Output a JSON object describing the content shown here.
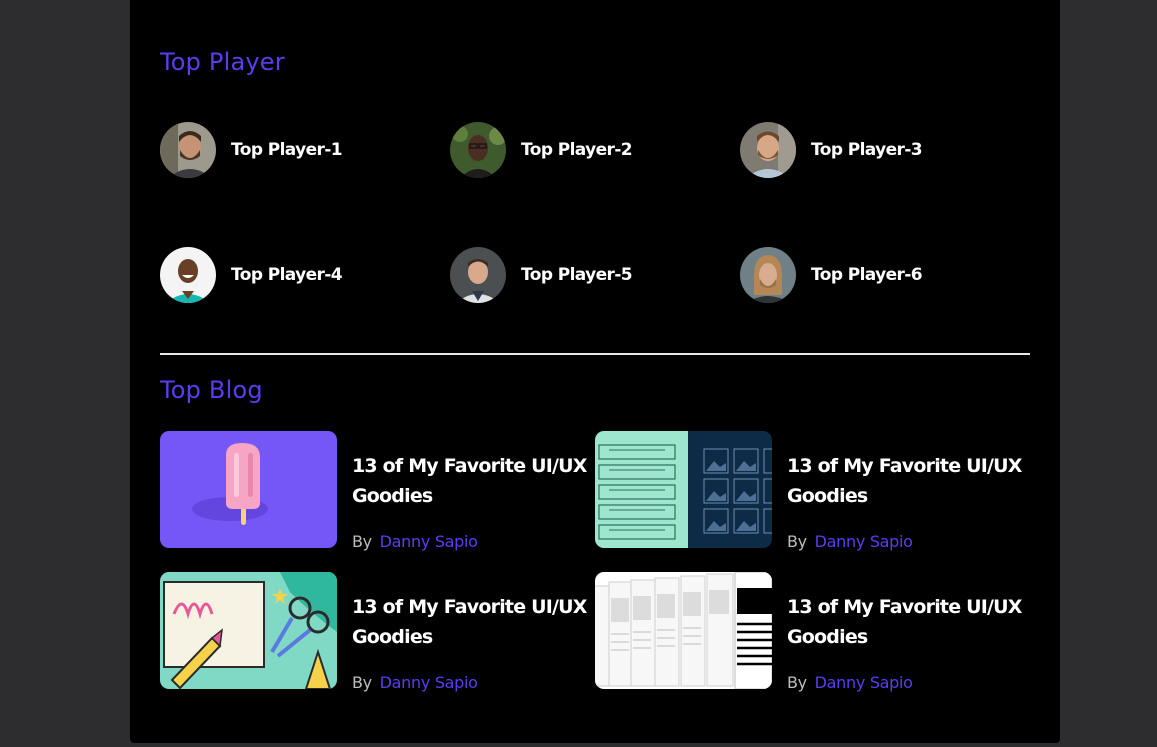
{
  "colors": {
    "page_bg": "#2d2c2f",
    "panel_bg": "#000000",
    "accent": "#5b3df0",
    "text": "#ffffff",
    "muted": "#bdbdbd"
  },
  "top_player": {
    "title": "Top Player",
    "players": [
      {
        "name": "Top Player-1",
        "avatar": "avatar-smiling-bearded-man"
      },
      {
        "name": "Top Player-2",
        "avatar": "avatar-man-with-glasses-green-background"
      },
      {
        "name": "Top Player-3",
        "avatar": "avatar-smiling-man-with-beard"
      },
      {
        "name": "Top Player-4",
        "avatar": "avatar-laughing-man-white-background"
      },
      {
        "name": "Top Player-5",
        "avatar": "avatar-smiling-man-dark-background"
      },
      {
        "name": "Top Player-6",
        "avatar": "avatar-man-with-long-hair"
      }
    ]
  },
  "top_blog": {
    "title": "Top Blog",
    "posts": [
      {
        "title": "13 of My Favorite UI/UX Goodies",
        "by_label": "By",
        "author": "Danny Sapio",
        "thumbnail": "popsicle-illustration"
      },
      {
        "title": "13 of My Favorite UI/UX Goodies",
        "by_label": "By",
        "author": "Danny Sapio",
        "thumbnail": "wireframe-layout-illustration"
      },
      {
        "title": "13 of My Favorite UI/UX Goodies",
        "by_label": "By",
        "author": "Danny Sapio",
        "thumbnail": "crafts-scissors-illustration"
      },
      {
        "title": "13 of My Favorite UI/UX Goodies",
        "by_label": "By",
        "author": "Danny Sapio",
        "thumbnail": "original-documents-illustration"
      }
    ]
  }
}
